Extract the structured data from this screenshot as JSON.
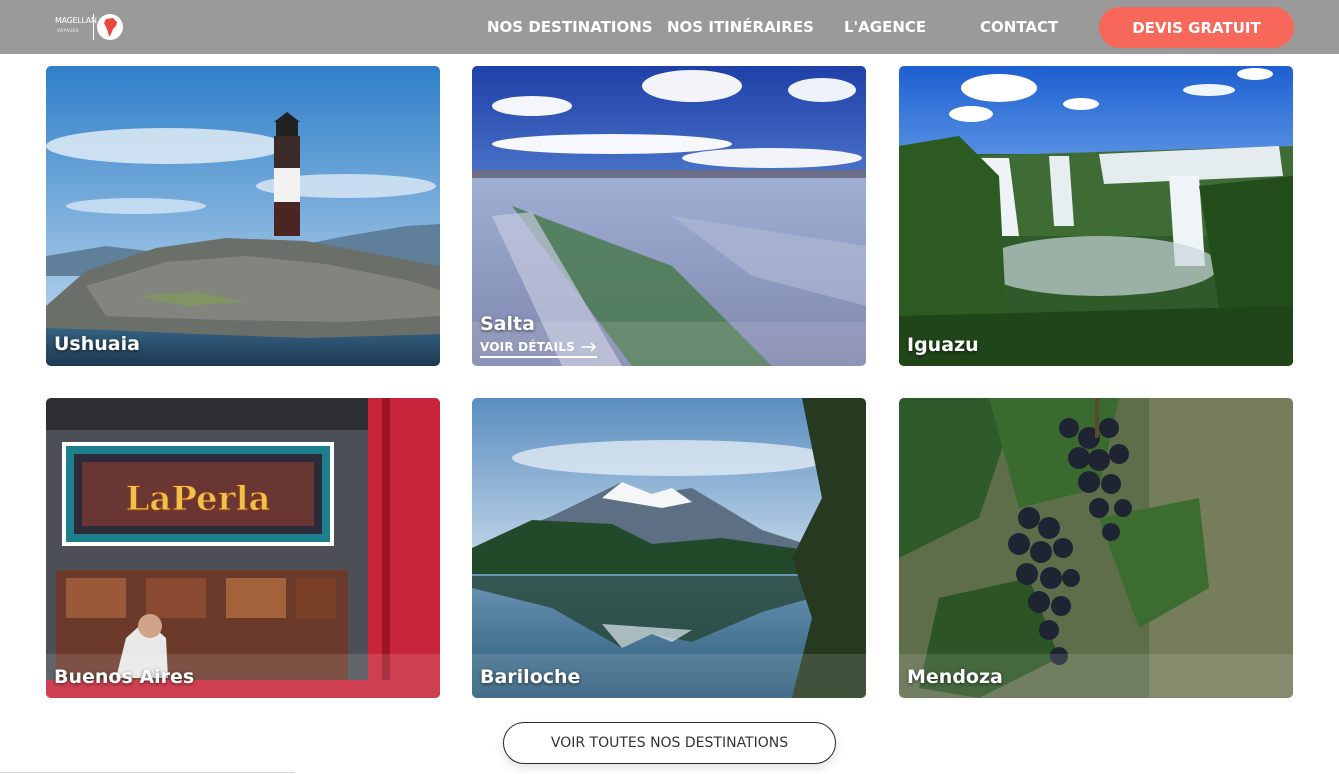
{
  "header": {
    "logo_text": "MAGELLAN",
    "logo_subtext": "VOYAGES",
    "nav": [
      {
        "label": "NOS DESTINATIONS"
      },
      {
        "label": "NOS ITINÉRAIRES"
      },
      {
        "label": "L'AGENCE"
      },
      {
        "label": "CONTACT"
      }
    ],
    "cta_label": "DEVIS GRATUIT"
  },
  "destinations": [
    {
      "name": "Ushuaia"
    },
    {
      "name": "Salta",
      "details_label": "VOIR DÉTAILS"
    },
    {
      "name": "Iguazu"
    },
    {
      "name": "Buenos Aires"
    },
    {
      "name": "Bariloche"
    },
    {
      "name": "Mendoza"
    }
  ],
  "all_destinations_label": "VOIR TOUTES NOS DESTINATIONS",
  "colors": {
    "header_bg": "#9a9a9a",
    "accent": "#f7675a"
  }
}
